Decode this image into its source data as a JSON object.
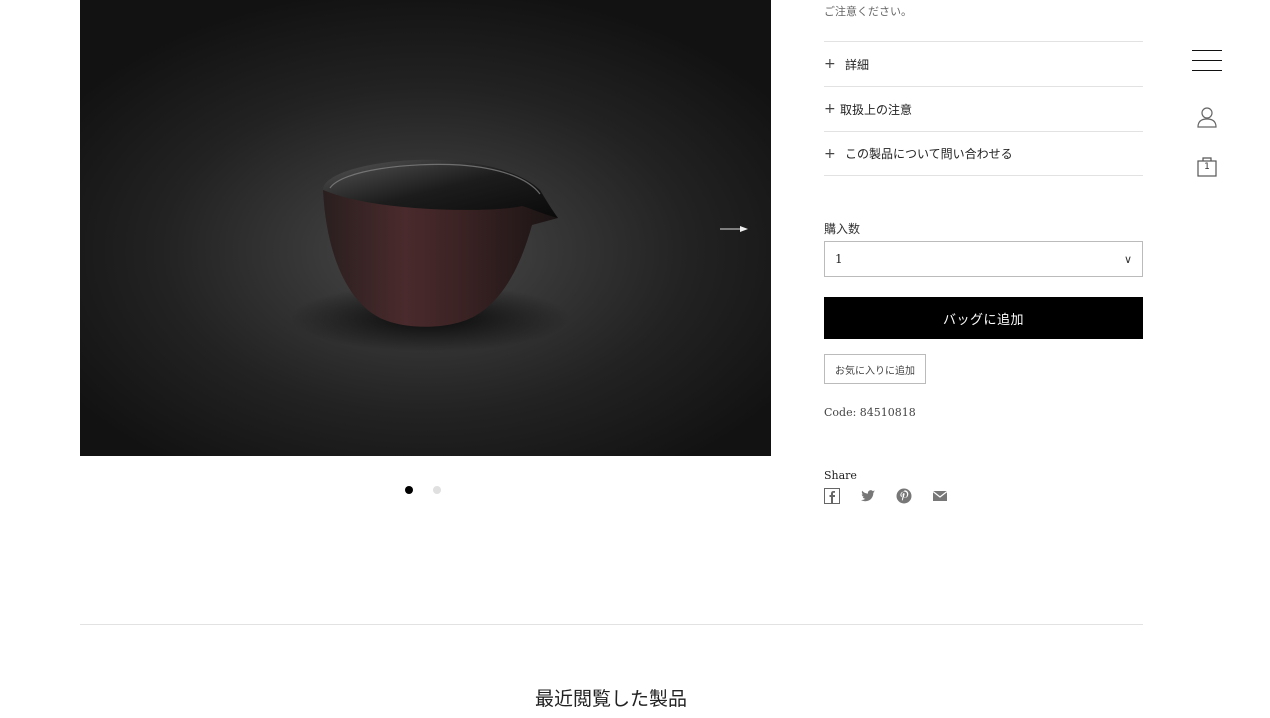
{
  "product": {
    "image_alt": "product-photo",
    "caution_text": "ご注意ください。",
    "accordions": [
      {
        "label": "詳細"
      },
      {
        "label": "取扱上の注意"
      },
      {
        "label": "この製品について問い合わせる"
      }
    ],
    "quantity_label": "購入数",
    "quantity_value": "1",
    "add_to_bag_label": "バッグに追加",
    "favorite_label": "お気に入りに追加",
    "code_text": "Code: 84510818",
    "share_label": "Share",
    "share_icons": [
      "facebook-icon",
      "twitter-icon",
      "pinterest-icon",
      "mail-icon"
    ]
  },
  "header": {
    "bag_count": "1"
  },
  "recent": {
    "title": "最近閲覧した製品"
  },
  "gallery": {
    "slide_count": 2,
    "active_index": 0
  },
  "colors": {
    "primary_button": "#000000",
    "divider": "#e2e2e2"
  }
}
